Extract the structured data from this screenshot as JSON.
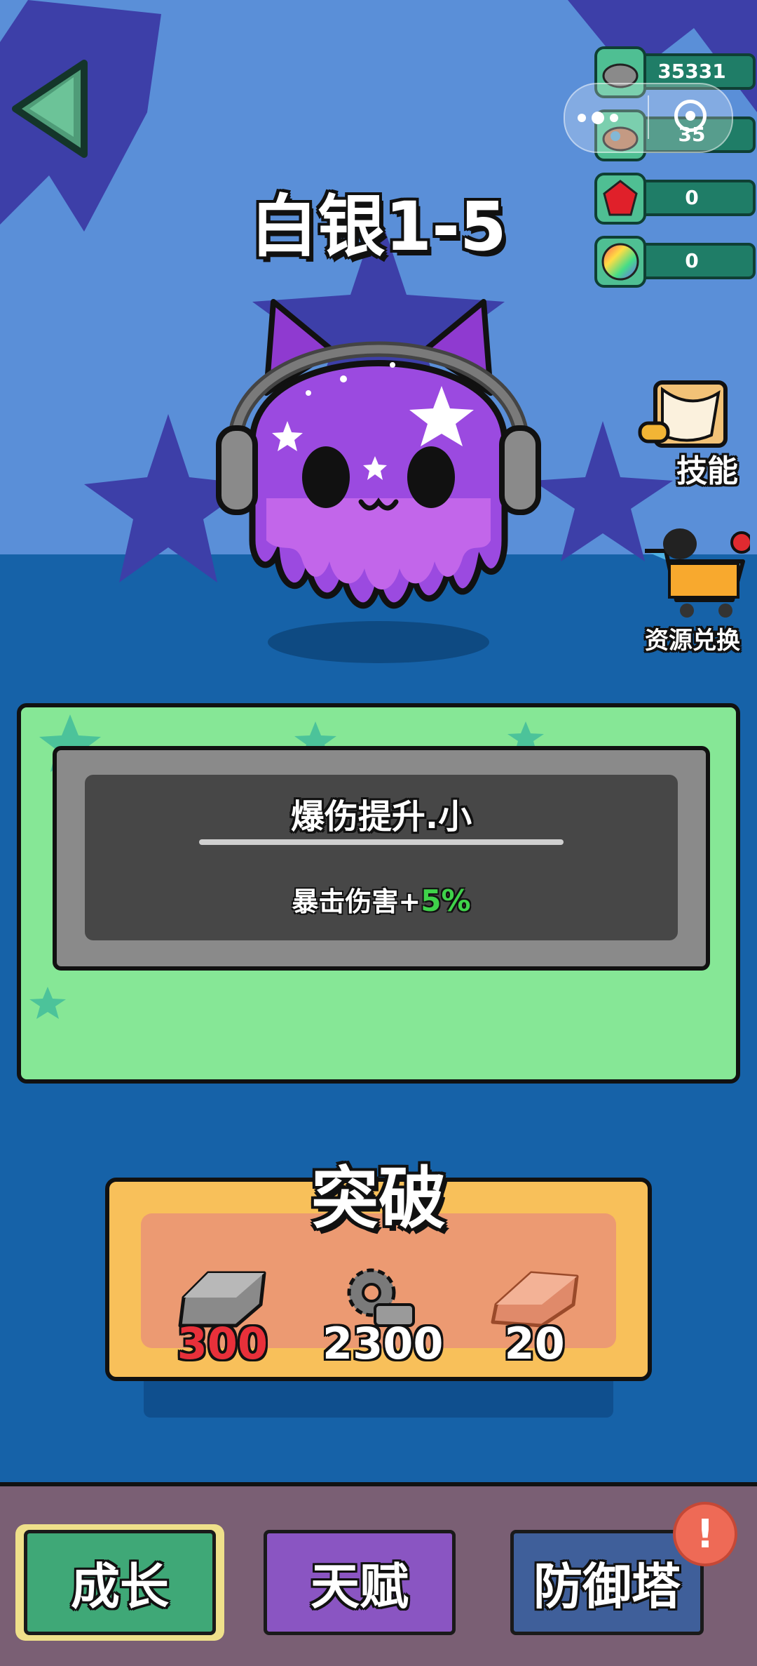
{
  "resources": [
    {
      "icon": "silver-ore-icon",
      "value": "35331"
    },
    {
      "icon": "mixed-ore-icon",
      "value": "35"
    },
    {
      "icon": "red-gem-icon",
      "value": "0"
    },
    {
      "icon": "rainbow-orb-icon",
      "value": "0"
    }
  ],
  "level_title": "白银1-5",
  "side_menu": {
    "skills_label": "技能",
    "exchange_label": "资源兑换"
  },
  "card": {
    "title": "爆伤提升.小",
    "effect_prefix": "暴击伤害+",
    "effect_value": "5%"
  },
  "breakthrough": {
    "title": "突破",
    "costs": [
      {
        "icon": "silver-ingot-icon",
        "value": "300",
        "color": "#e8303a"
      },
      {
        "icon": "gear-parts-icon",
        "value": "2300",
        "color": "#ffffff"
      },
      {
        "icon": "copper-ingot-icon",
        "value": "20",
        "color": "#ffffff"
      }
    ]
  },
  "tabs": [
    {
      "label": "成长",
      "color": "#3fa877",
      "active": true
    },
    {
      "label": "天赋",
      "color": "#8a55c2",
      "active": false
    },
    {
      "label": "防御塔",
      "color": "#3f5f9a",
      "active": false
    }
  ],
  "notification_badge": "!"
}
